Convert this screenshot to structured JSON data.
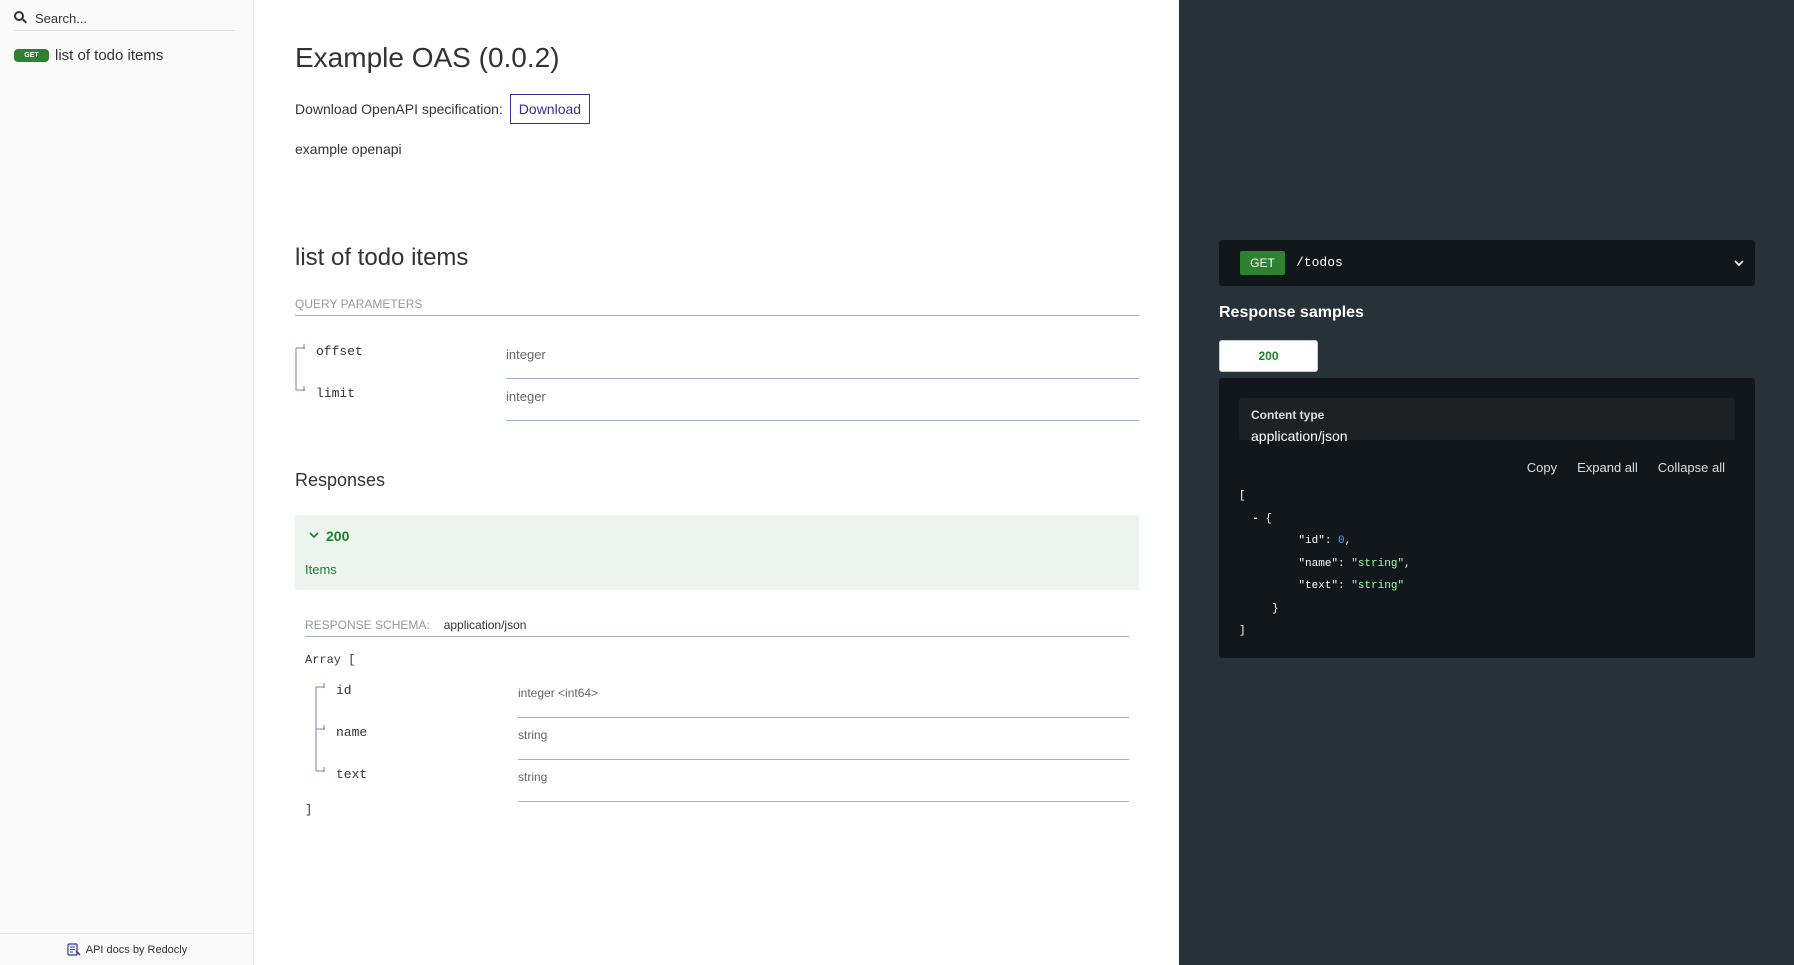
{
  "sidebar": {
    "search": {
      "placeholder": "Search..."
    },
    "items": [
      {
        "method": "GET",
        "label": "list of todo items"
      }
    ],
    "footer": "API docs by Redocly"
  },
  "main": {
    "title": "Example OAS (0.0.2)",
    "download": {
      "label": "Download OpenAPI specification:",
      "button": "Download"
    },
    "description": "example openapi",
    "operation": {
      "title": "list of todo items",
      "query_parameters_header": "QUERY PARAMETERS",
      "parameters": [
        {
          "name": "offset",
          "type": "integer"
        },
        {
          "name": "limit",
          "type": "integer"
        }
      ],
      "responses_title": "Responses",
      "response": {
        "code": "200",
        "description": "Items"
      },
      "schema": {
        "label": "RESPONSE SCHEMA:",
        "content_type": "application/json",
        "array_open": "Array [",
        "array_close": "]",
        "fields": [
          {
            "name": "id",
            "type": "integer <int64>"
          },
          {
            "name": "name",
            "type": "string"
          },
          {
            "name": "text",
            "type": "string"
          }
        ]
      }
    }
  },
  "right_panel": {
    "endpoint": {
      "method": "GET",
      "path": "/todos"
    },
    "samples_title": "Response samples",
    "tab": "200",
    "content_type_label": "Content type",
    "content_type_value": "application/json",
    "actions": {
      "copy": "Copy",
      "expand": "Expand all",
      "collapse": "Collapse all"
    },
    "sample": {
      "open_bracket": "[",
      "toggle": "-",
      "open_brace": "{",
      "id_key": "\"id\"",
      "id_value": "0",
      "name_key": "\"name\"",
      "name_value": "\"string\"",
      "text_key": "\"text\"",
      "text_value": "\"string\"",
      "close_brace": "}",
      "close_bracket": "]"
    }
  },
  "colors": {
    "get_badge": "#2f8132",
    "accent": "#32329f",
    "success": "#1d8127",
    "dark_panel": "#263238",
    "code_bg": "#11171a"
  }
}
